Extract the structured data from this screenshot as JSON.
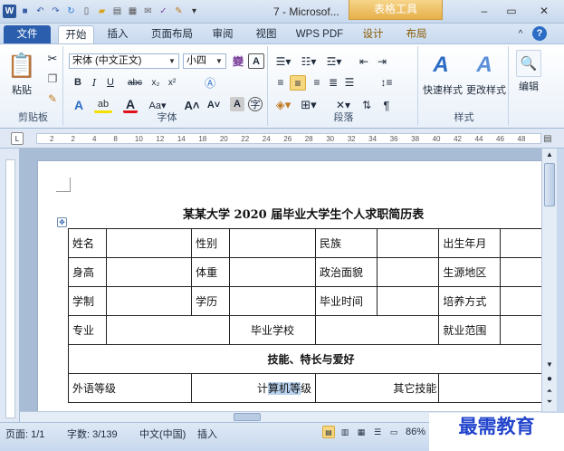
{
  "window": {
    "title": "7 - Microsof...",
    "context_tab": "表格工具"
  },
  "tabs": [
    "文件",
    "开始",
    "插入",
    "页面布局",
    "审阅",
    "视图",
    "WPS PDF",
    "设计",
    "布局"
  ],
  "ribbon": {
    "clipboard": {
      "paste": "粘贴",
      "label": "剪贴板"
    },
    "font": {
      "name": "宋体 (中文正文)",
      "size": "小四",
      "label": "字体"
    },
    "paragraph": {
      "label": "段落"
    },
    "styles": {
      "quick": "快速样式",
      "change": "更改样式",
      "label": "样式"
    },
    "editing": {
      "label": "编辑"
    }
  },
  "ruler": {
    "ticks": [
      "2",
      "2",
      "4",
      "8",
      "10",
      "12",
      "14",
      "18",
      "20",
      "22",
      "24",
      "26",
      "28",
      "30",
      "32",
      "34",
      "36",
      "38",
      "40",
      "42",
      "44",
      "46",
      "48"
    ]
  },
  "document": {
    "title": "某某大学 2020 届毕业大学生个人求职简历表",
    "rows": [
      [
        "姓名",
        "",
        "性别",
        "",
        "民族",
        "",
        "出生年月",
        ""
      ],
      [
        "身高",
        "",
        "体重",
        "",
        "政治面貌",
        "",
        "生源地区",
        ""
      ],
      [
        "学制",
        "",
        "学历",
        "",
        "毕业时间",
        "",
        "培养方式",
        ""
      ]
    ],
    "major_row": {
      "c1": "专业",
      "c2": "毕业学校",
      "c3": "就业范围"
    },
    "section": "技能、特长与爱好",
    "skills": {
      "c1": "外语等级",
      "c2a": "计",
      "c2hl": "算机等",
      "c2b": "级",
      "c3": "其它技能"
    }
  },
  "status": {
    "page": "页面: 1/1",
    "words": "字数: 3/139",
    "lang": "中文(中国)",
    "insert": "插入",
    "zoom": "86%"
  },
  "watermark": "最需教育"
}
